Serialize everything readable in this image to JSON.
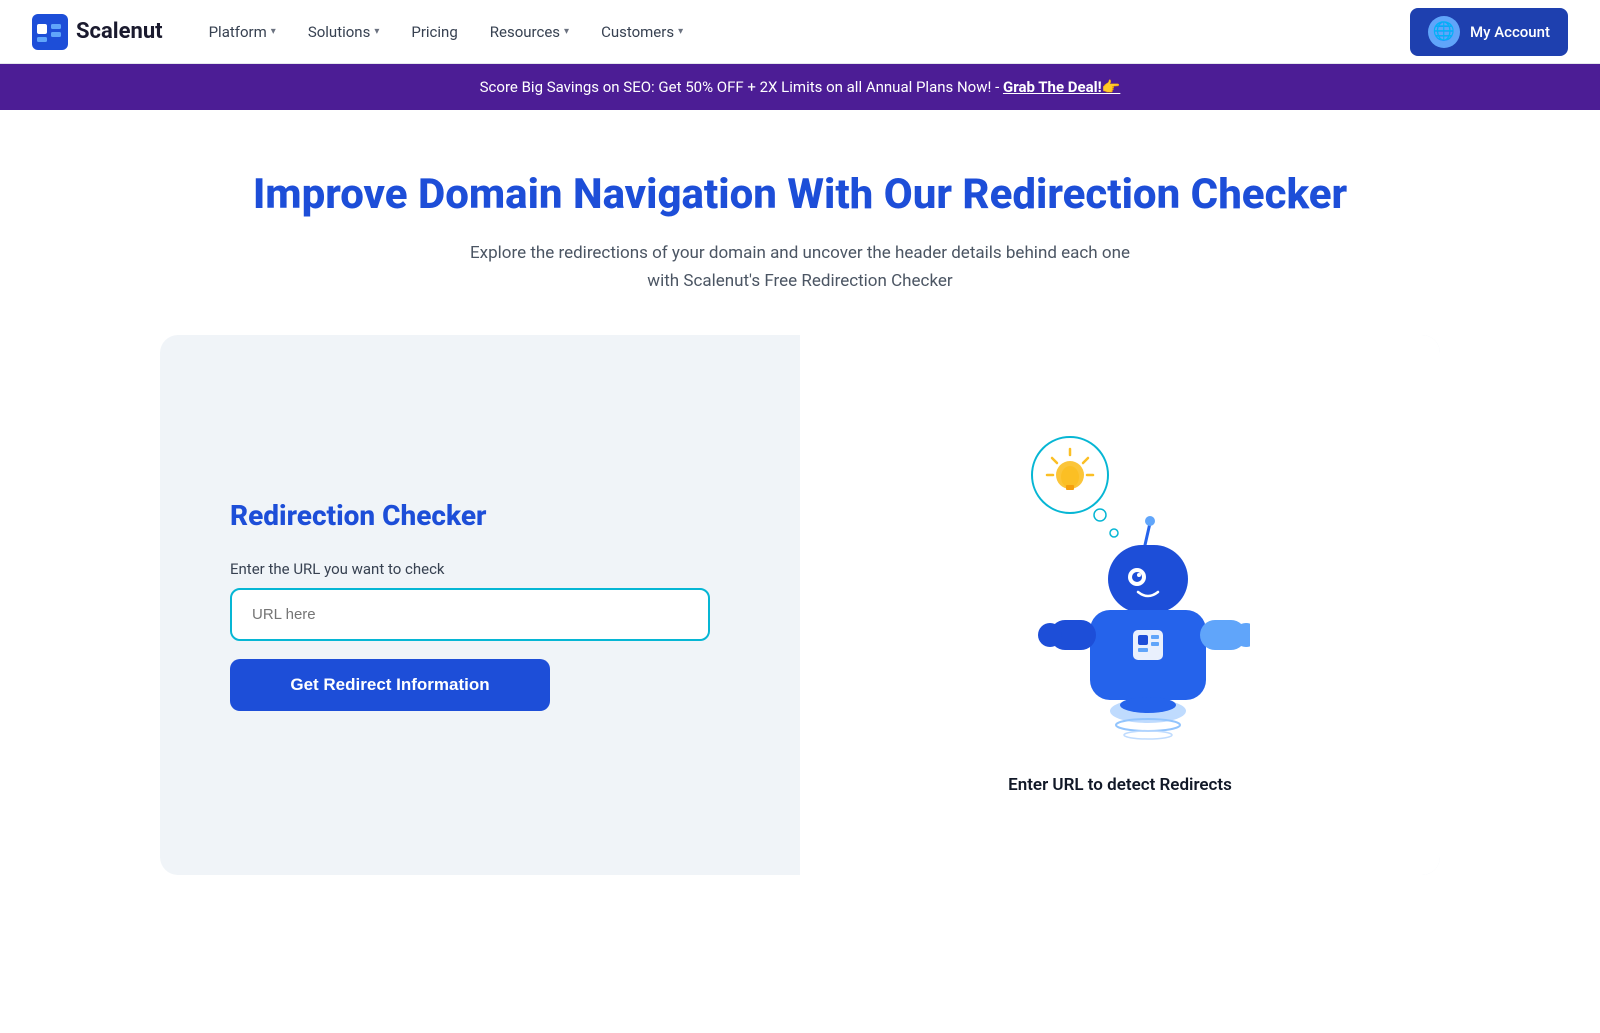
{
  "nav": {
    "logo_text": "Scalenut",
    "items": [
      {
        "label": "Platform",
        "has_dropdown": true
      },
      {
        "label": "Solutions",
        "has_dropdown": true
      },
      {
        "label": "Pricing",
        "has_dropdown": false
      },
      {
        "label": "Resources",
        "has_dropdown": true
      },
      {
        "label": "Customers",
        "has_dropdown": true
      }
    ],
    "account_label": "My Account"
  },
  "promo": {
    "text": "Score Big Savings on SEO: Get 50% OFF + 2X Limits on all Annual Plans Now! - ",
    "link_text": "Grab The Deal!👉"
  },
  "hero": {
    "title": "Improve Domain Navigation With Our Redirection Checker",
    "subtitle": "Explore the redirections of your domain and uncover the header details behind each one with Scalenut's Free Redirection Checker"
  },
  "tool": {
    "card_title": "Redirection Checker",
    "input_label": "Enter the URL you want to check",
    "input_placeholder": "URL here",
    "button_label": "Get Redirect Information",
    "robot_caption": "Enter URL to detect Redirects"
  }
}
